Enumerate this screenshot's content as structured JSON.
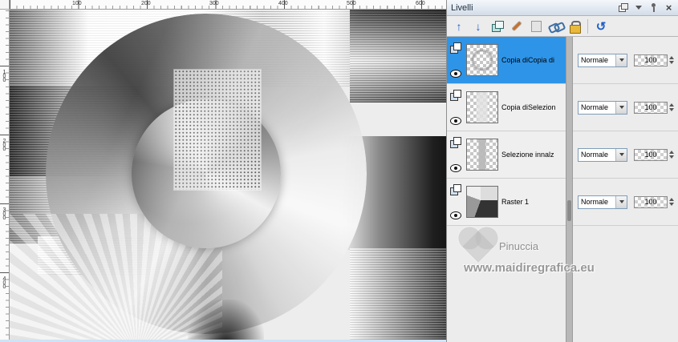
{
  "rulers": {
    "horizontal": [
      "100",
      "200",
      "300",
      "400",
      "500",
      "600"
    ],
    "vertical": [
      "100",
      "200",
      "300",
      "400"
    ]
  },
  "panel": {
    "title": "Livelli",
    "layers": [
      {
        "name": "Copia diCopia di",
        "blend": "Normale",
        "opacity": "100",
        "selected": true
      },
      {
        "name": "Copia diSelezion",
        "blend": "Normale",
        "opacity": "100",
        "selected": false
      },
      {
        "name": "Selezione innalz",
        "blend": "Normale",
        "opacity": "100",
        "selected": false
      },
      {
        "name": "Raster 1",
        "blend": "Normale",
        "opacity": "100",
        "selected": false
      }
    ]
  },
  "watermark": {
    "name": "Pinuccia",
    "site": "www.maidiregrafica.eu"
  },
  "colors": {
    "selection": "#2e94e8",
    "panel_bg": "#ececec"
  }
}
